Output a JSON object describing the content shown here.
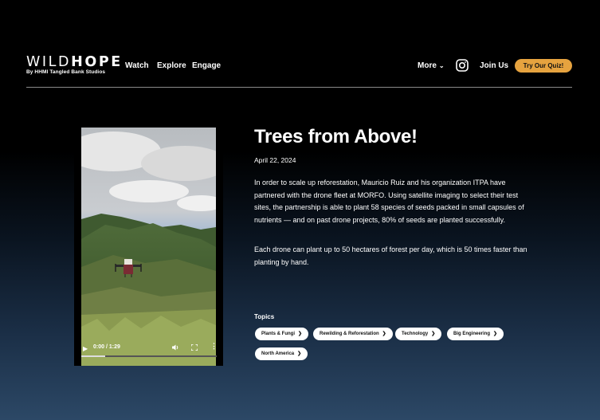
{
  "brand": {
    "wordmark_light": "WILD",
    "wordmark_bold": "HOPE",
    "subtitle": "By HHMI Tangled Bank Studios"
  },
  "nav": {
    "left": [
      "Watch",
      "Explore",
      "Engage"
    ],
    "more_label": "More",
    "join_label": "Join Us",
    "quiz_label": "Try Our Quiz!"
  },
  "video": {
    "time": "0:00 / 1:29",
    "progress_fraction": 0.0
  },
  "article": {
    "title": "Trees from Above!",
    "date": "April 22, 2024",
    "paragraphs": [
      "In order to scale up reforestation, Mauricio Ruiz and his organization ITPA have partnered with the drone fleet at MORFO. Using satellite imaging to select their test sites, the partnership is able to plant 58 species of seeds packed in small capsules of nutrients — and on past drone projects, 80% of seeds are planted successfully.",
      "Each drone can plant up to 50 hectares of forest per day, which is 50 times faster than planting by hand."
    ]
  },
  "topics": {
    "label": "Topics",
    "tags": [
      "Plants & Fungi",
      "Rewilding & Reforestation",
      "Technology",
      "Big Engineering",
      "North America"
    ]
  },
  "colors": {
    "accent": "#e6a33f",
    "background_top": "#000000",
    "background_bottom": "#2c4866"
  }
}
